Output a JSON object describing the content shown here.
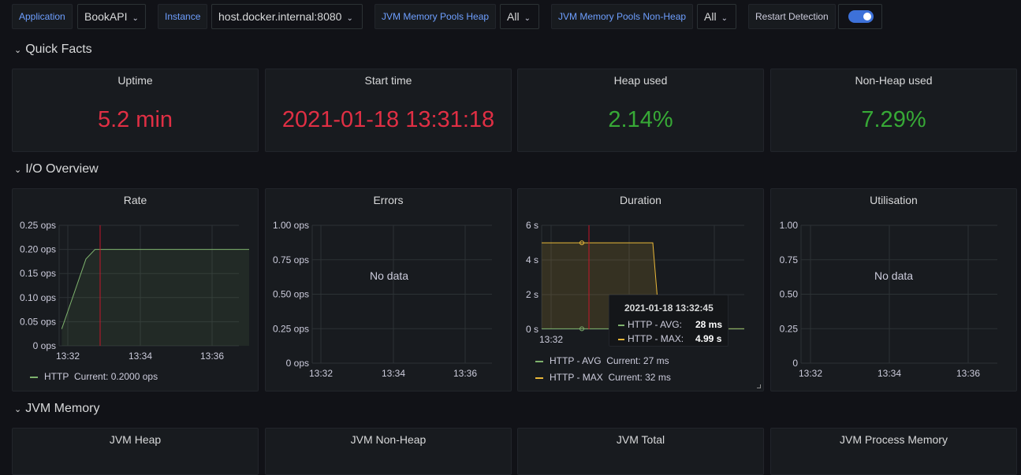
{
  "variables": {
    "application": {
      "label": "Application",
      "value": "BookAPI"
    },
    "instance": {
      "label": "Instance",
      "value": "host.docker.internal:8080"
    },
    "heap_pools": {
      "label": "JVM Memory Pools Heap",
      "value": "All"
    },
    "nonheap_pools": {
      "label": "JVM Memory Pools Non-Heap",
      "value": "All"
    },
    "restart_detection": {
      "label": "Restart Detection",
      "enabled": true
    }
  },
  "rows": {
    "quick_facts": "Quick Facts",
    "io_overview": "I/O Overview",
    "jvm_memory": "JVM Memory"
  },
  "stats": {
    "uptime": {
      "title": "Uptime",
      "value": "5.2 min"
    },
    "start_time": {
      "title": "Start time",
      "value": "2021-01-18 13:31:18"
    },
    "heap_used": {
      "title": "Heap used",
      "value": "2.14%"
    },
    "nonheap_used": {
      "title": "Non-Heap used",
      "value": "7.29%"
    }
  },
  "colors": {
    "stat_red": "#e02f44",
    "stat_green": "#37a936",
    "series_green": "#7eb26d",
    "series_yellow": "#eab839",
    "marker_red": "#c4162a"
  },
  "no_data_text": "No data",
  "chart_data": [
    {
      "type": "line",
      "title": "Rate",
      "y_ticks": [
        "0 ops",
        "0.05 ops",
        "0.10 ops",
        "0.15 ops",
        "0.20 ops",
        "0.25 ops"
      ],
      "x_ticks": [
        "13:32",
        "13:34",
        "13:36"
      ],
      "ylim": [
        0,
        0.25
      ],
      "series": [
        {
          "name": "HTTP",
          "points": [
            [
              "13:31:50",
              0.035
            ],
            [
              "13:32:30",
              0.18
            ],
            [
              "13:32:45",
              0.2
            ],
            [
              "13:37:00",
              0.2
            ]
          ]
        }
      ],
      "legend": [
        {
          "name": "HTTP",
          "current": "Current: 0.2000 ops"
        }
      ]
    },
    {
      "type": "line",
      "title": "Errors",
      "y_ticks": [
        "0 ops",
        "0.25 ops",
        "0.50 ops",
        "0.75 ops",
        "1.00 ops"
      ],
      "x_ticks": [
        "13:32",
        "13:34",
        "13:36"
      ],
      "series": []
    },
    {
      "type": "line",
      "title": "Duration",
      "y_ticks": [
        "0 s",
        "2 s",
        "4 s",
        "6 s"
      ],
      "x_ticks": [
        "13:32"
      ],
      "ylim": [
        0,
        6
      ],
      "series": [
        {
          "name": "HTTP - AVG",
          "current": "Current: 27 ms"
        },
        {
          "name": "HTTP - MAX",
          "current": "Current: 32 ms"
        }
      ],
      "tooltip": {
        "time": "2021-01-18 13:32:45",
        "rows": [
          {
            "name": "HTTP - AVG:",
            "value": "28 ms"
          },
          {
            "name": "HTTP - MAX:",
            "value": "4.99 s"
          }
        ]
      }
    },
    {
      "type": "line",
      "title": "Utilisation",
      "y_ticks": [
        "0",
        "0.25",
        "0.50",
        "0.75",
        "1.00"
      ],
      "x_ticks": [
        "13:32",
        "13:34",
        "13:36"
      ],
      "series": []
    }
  ],
  "memory_panels": [
    "JVM Heap",
    "JVM Non-Heap",
    "JVM Total",
    "JVM Process Memory"
  ]
}
